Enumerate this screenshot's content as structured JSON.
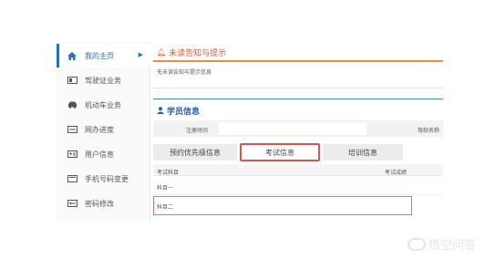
{
  "sidebar": {
    "items": [
      {
        "label": "我的主页",
        "icon": "home-icon",
        "active": true
      },
      {
        "label": "驾驶证业务",
        "icon": "id-card-icon",
        "active": false
      },
      {
        "label": "机动车业务",
        "icon": "car-icon",
        "active": false
      },
      {
        "label": "网办进度",
        "icon": "progress-icon",
        "active": false
      },
      {
        "label": "用户信息",
        "icon": "user-card-icon",
        "active": false
      },
      {
        "label": "手机号码变更",
        "icon": "phone-icon",
        "active": false
      },
      {
        "label": "密码修改",
        "icon": "key-icon",
        "active": false
      }
    ]
  },
  "notice": {
    "title": "未读告知与提示",
    "body": "无未读告知与提示信息"
  },
  "student": {
    "title": "学员信息",
    "register_time_label": "注册时间",
    "register_time_value": "",
    "school_label": "驾校名称"
  },
  "tabs": {
    "priority": "预约优先级信息",
    "exam": "考试信息",
    "training": "培训信息"
  },
  "exam_table": {
    "headers": {
      "subject": "考试科目",
      "score": "考试成绩"
    },
    "rows": [
      {
        "subject": "科目一"
      },
      {
        "subject": "科目二"
      }
    ]
  },
  "watermark": {
    "text": "悟空问答"
  },
  "colors": {
    "accent_blue": "#2a6fb8",
    "notice_orange": "#f08a3c",
    "highlight_red": "#d9534f"
  }
}
